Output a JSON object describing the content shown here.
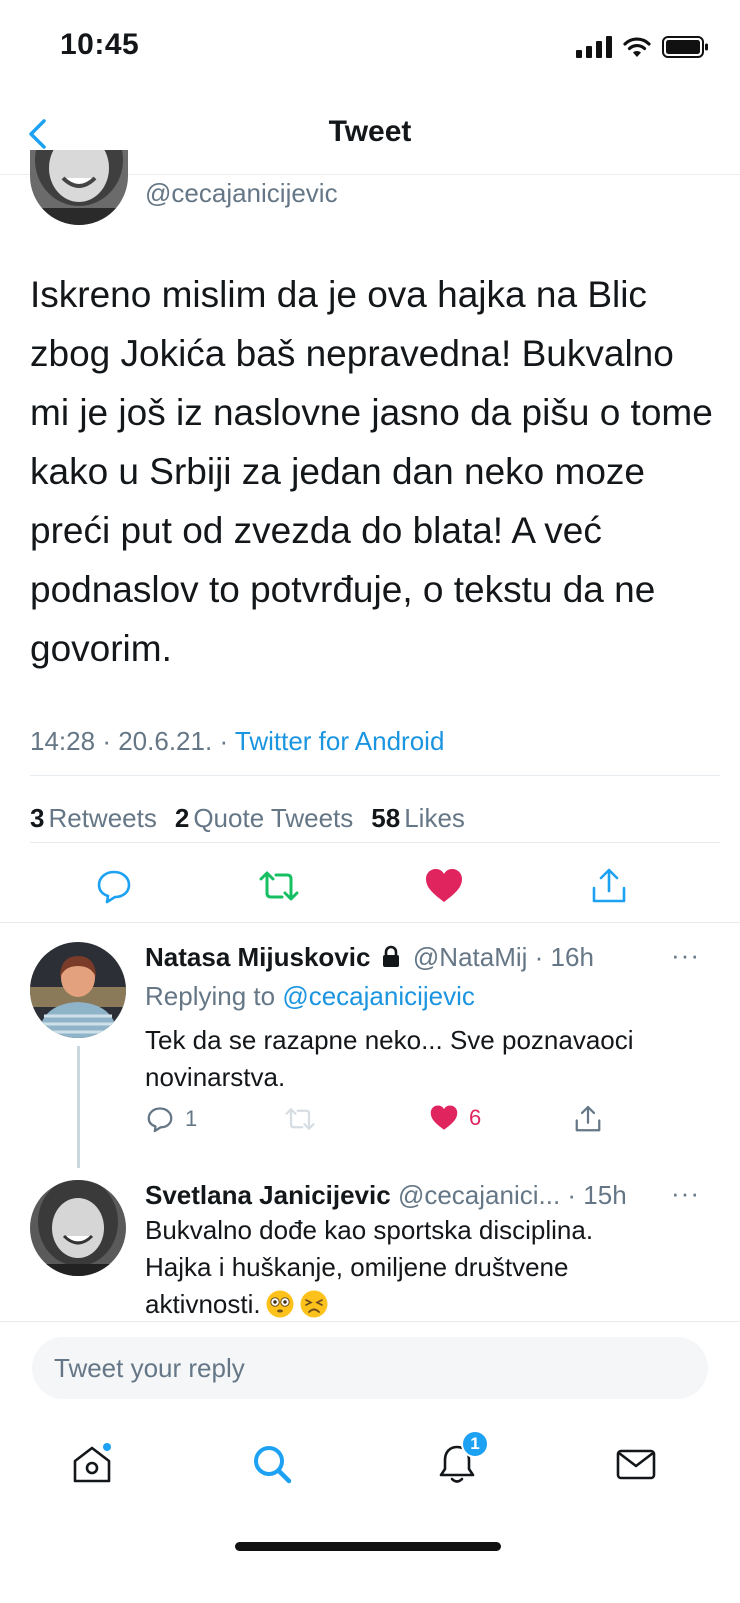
{
  "status_bar": {
    "time": "10:45"
  },
  "nav": {
    "title": "Tweet",
    "back_icon": "chevron-left-icon"
  },
  "tweet": {
    "author_handle": "@cecajanicijevic",
    "text": "Iskreno mislim da je ova hajka na Blic zbog Jokića baš nepravedna! Bukvalno mi je još iz naslovne jasno da pišu o tome kako u Srbiji za jedan dan neko moze preći put od zvezda do blata! A već podnaslov to potvrđuje, o tekstu da ne govorim.",
    "time": "14:28",
    "date": "20.6.21.",
    "source": "Twitter for Android",
    "sep": "·",
    "stats": {
      "retweets_count": "3",
      "retweets_label": "Retweets",
      "quotes_count": "2",
      "quotes_label": "Quote Tweets",
      "likes_count": "58",
      "likes_label": "Likes"
    }
  },
  "replies": [
    {
      "name": "Natasa Mijuskovic",
      "handle": "@NataMij",
      "time": "· 16h",
      "replying_prefix": "Replying to",
      "replying_to": "@cecajanicijevic",
      "text": "Tek da se razapne neko... Sve poznavaoci novinarstva.",
      "reply_count": "1",
      "like_count": "6",
      "more": "···"
    },
    {
      "name": "Svetlana Janicijevic",
      "handle": "@cecajanici...",
      "time": "· 15h",
      "text_line1": "Bukvalno dođe kao sportska disciplina.",
      "text_line2": "Hajka i huškanje, omiljene društvene",
      "text_line3": "aktivnosti.",
      "more": "···"
    }
  ],
  "composer": {
    "placeholder": "Tweet your reply"
  },
  "tab_bar": {
    "notifications_badge": "1"
  },
  "colors": {
    "accent": "#1da1f2",
    "link": "#1b95e0",
    "like": "#e0245e",
    "retweet": "#17bf63",
    "muted": "#657786"
  }
}
